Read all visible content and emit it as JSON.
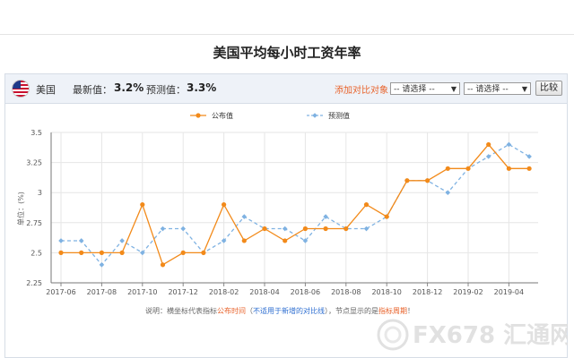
{
  "page": {
    "title": "美国平均每小时工资年率"
  },
  "info": {
    "country": "美国",
    "latest_label": "最新值：",
    "latest_value": "3.2%",
    "forecast_label": "预测值：",
    "forecast_value": "3.3%",
    "compare_label": "添加对比对象：",
    "select_1": "-- 请选择 --",
    "select_2": "-- 请选择 --",
    "compare_button": "比较"
  },
  "colors": {
    "published": "#f28a1a",
    "forecast": "#7fb2e2",
    "accent": "#e8622a"
  },
  "chart_data": {
    "type": "line",
    "title": "",
    "xlabel": "",
    "ylabel": "单位：(%)",
    "ylim": [
      2.25,
      3.5
    ],
    "yticks": [
      "2.25",
      "2.5",
      "2.75",
      "3",
      "3.25",
      "3.5"
    ],
    "x_tick_labels": [
      "2017-06",
      "2017-08",
      "2017-10",
      "2017-12",
      "2018-02",
      "2018-04",
      "2018-06",
      "2018-08",
      "2018-10",
      "2018-12",
      "2019-02",
      "2019-04"
    ],
    "x": [
      "2017-06",
      "2017-07",
      "2017-08",
      "2017-09",
      "2017-10",
      "2017-11",
      "2017-12",
      "2018-01",
      "2018-02",
      "2018-03",
      "2018-04",
      "2018-05",
      "2018-06",
      "2018-07",
      "2018-08",
      "2018-09",
      "2018-10",
      "2018-11",
      "2018-12",
      "2019-01",
      "2019-02",
      "2019-03",
      "2019-04",
      "2019-05"
    ],
    "series": [
      {
        "name": "公布值",
        "values": [
          2.5,
          2.5,
          2.5,
          2.5,
          2.9,
          2.4,
          2.5,
          2.5,
          2.9,
          2.6,
          2.7,
          2.6,
          2.7,
          2.7,
          2.7,
          2.9,
          2.8,
          3.1,
          3.1,
          3.2,
          3.2,
          3.4,
          3.2,
          3.2
        ]
      },
      {
        "name": "预测值",
        "values": [
          2.6,
          2.6,
          2.4,
          2.6,
          2.5,
          2.7,
          2.7,
          2.5,
          2.6,
          2.8,
          2.7,
          2.7,
          2.6,
          2.8,
          2.7,
          2.7,
          2.8,
          3.1,
          3.1,
          3.0,
          3.2,
          3.3,
          3.4,
          3.3
        ]
      }
    ],
    "grid": true,
    "legend": "top-center"
  },
  "footnote": {
    "prefix": "说明：横坐标代表指标",
    "highlight_1": "公布时间",
    "middle_1": "（",
    "highlight_2": "不适用于新增的对比线",
    "middle_2": "），节点显示的是",
    "highlight_3": "指标周期",
    "suffix": "！"
  },
  "watermark": {
    "text": "FX678 汇通网"
  }
}
